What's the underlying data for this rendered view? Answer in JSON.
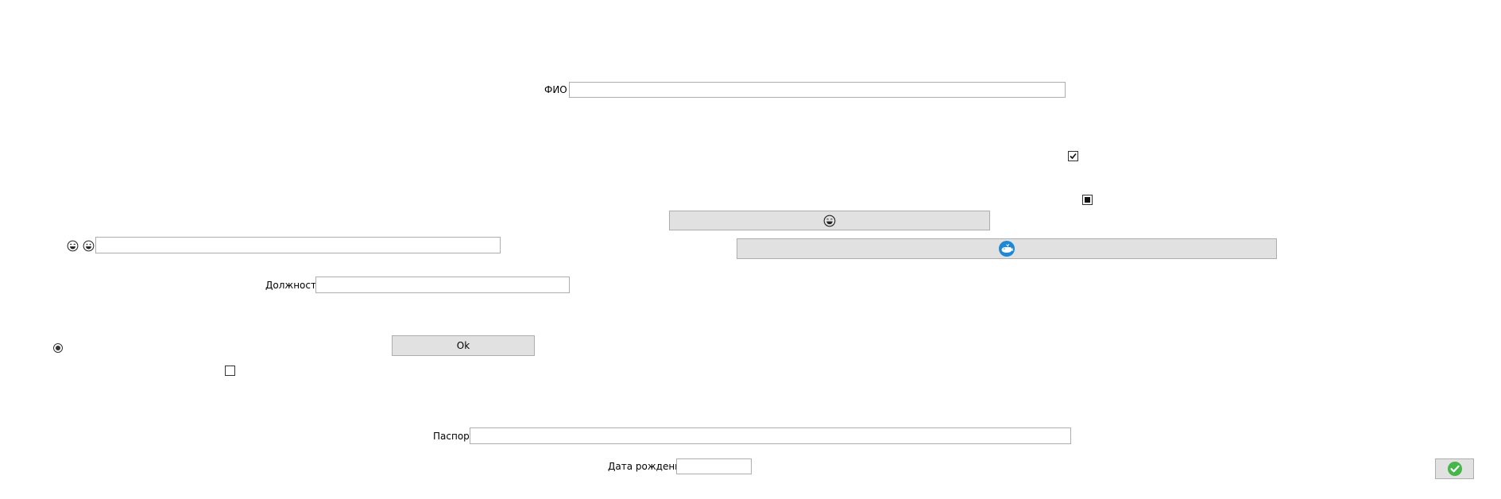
{
  "form": {
    "fio_label": "ФИО",
    "fio_value": "",
    "position_label": "Должность",
    "position_value": "",
    "passport_label": "Паспорт",
    "passport_value": "",
    "birthdate_label": "Дата рождения",
    "birthdate_value": "",
    "emoji_field_value": ""
  },
  "buttons": {
    "ok_label": "Ok"
  },
  "controls": {
    "checkbox_top_checked": true,
    "checkbox_bottom_checked": false,
    "radio_selected": true
  },
  "icons": {
    "emoji_face_a": "grinning-face-icon",
    "emoji_face_b": "smiling-face-icon",
    "button_top_icon": "laughing-face-icon",
    "button_blue_icon": "whale-icon",
    "confirm_icon": "checkmark-icon"
  },
  "colors": {
    "button_bg": "#e1e1e1",
    "border": "#adadad",
    "whale_blue": "#1e88d6",
    "confirm_green": "#45b649"
  }
}
